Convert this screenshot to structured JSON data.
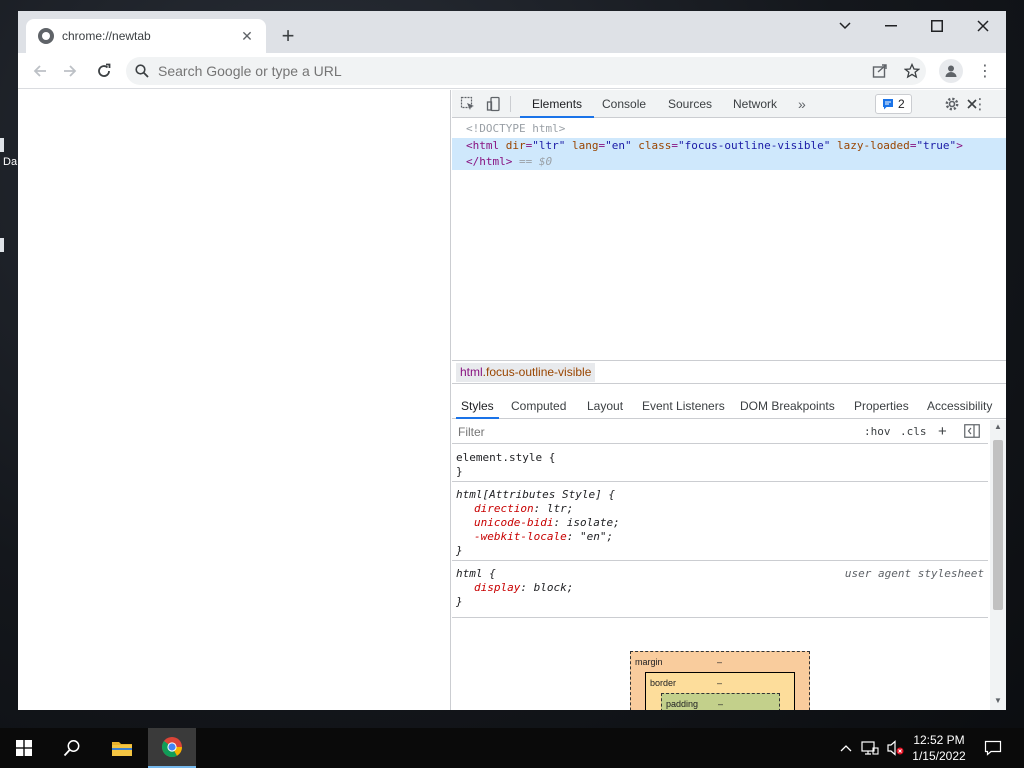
{
  "desktop": {
    "icon_label": "Da"
  },
  "browser": {
    "tab": {
      "title": "chrome://newtab"
    },
    "omnibox": {
      "placeholder": "Search Google or type a URL"
    }
  },
  "devtools": {
    "tabs": [
      "Elements",
      "Console",
      "Sources",
      "Network"
    ],
    "issues_count": "2",
    "dom": {
      "doctype": "<!DOCTYPE html>",
      "html_open": {
        "tag": "html",
        "attrs": [
          {
            "name": "dir",
            "value": "\"ltr\""
          },
          {
            "name": "lang",
            "value": "\"en\""
          },
          {
            "name": "class",
            "value": "\"focus-outline-visible\""
          },
          {
            "name": "lazy-loaded",
            "value": "\"true\""
          }
        ]
      },
      "html_close": "</html>",
      "selected_marker": "== $0"
    },
    "breadcrumb": {
      "tag": "html",
      "cls": ".focus-outline-visible"
    },
    "subtabs": [
      "Styles",
      "Computed",
      "Layout",
      "Event Listeners",
      "DOM Breakpoints",
      "Properties",
      "Accessibility"
    ],
    "filter": {
      "placeholder": "Filter"
    },
    "filter_buttons": {
      "hov": ":hov",
      "cls": ".cls",
      "add": "+"
    },
    "rules": {
      "element_style": {
        "selector": "element.style {",
        "close": "}"
      },
      "attr_style": {
        "selector": "html[Attributes Style] {",
        "props": [
          {
            "name": "direction",
            "value": "ltr;"
          },
          {
            "name": "unicode-bidi",
            "value": "isolate;"
          },
          {
            "name": "-webkit-locale",
            "value": "\"en\";"
          }
        ],
        "close": "}"
      },
      "ua": {
        "selector": "html {",
        "origin": "user agent stylesheet",
        "props": [
          {
            "name": "display",
            "value": "block;"
          }
        ],
        "close": "}"
      }
    },
    "box_model": {
      "margin": "margin",
      "border": "border",
      "padding": "padding",
      "dash": "–"
    }
  },
  "taskbar": {
    "time": "12:52 PM",
    "date": "1/15/2022"
  }
}
